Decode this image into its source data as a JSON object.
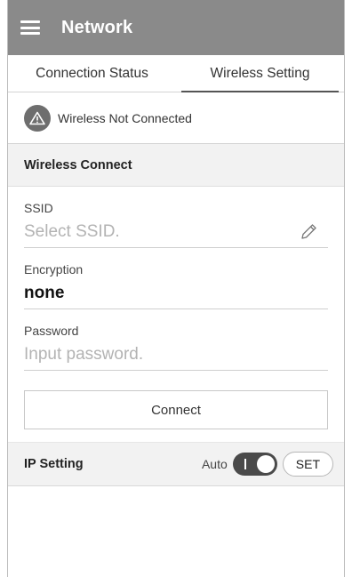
{
  "appbar": {
    "title": "Network",
    "menu_icon": "hamburger-menu-icon"
  },
  "tabs": [
    {
      "label": "Connection Status",
      "active": false
    },
    {
      "label": "Wireless Setting",
      "active": true
    }
  ],
  "status": {
    "icon": "warning-icon",
    "text": "Wireless Not Connected"
  },
  "wireless_connect": {
    "header": "Wireless Connect",
    "ssid": {
      "label": "SSID",
      "value": "",
      "placeholder": "Select SSID.",
      "edit_icon": "pencil-icon"
    },
    "encryption": {
      "label": "Encryption",
      "value": "none"
    },
    "password": {
      "label": "Password",
      "value": "",
      "placeholder": "Input password."
    },
    "connect_label": "Connect"
  },
  "ip_setting": {
    "title": "IP Setting",
    "mode_label": "Auto",
    "toggle_on": true,
    "set_label": "SET"
  },
  "colors": {
    "appbar": "#8a8a8a",
    "section_bg": "#f2f2f2",
    "toggle": "#4a4a4a"
  }
}
